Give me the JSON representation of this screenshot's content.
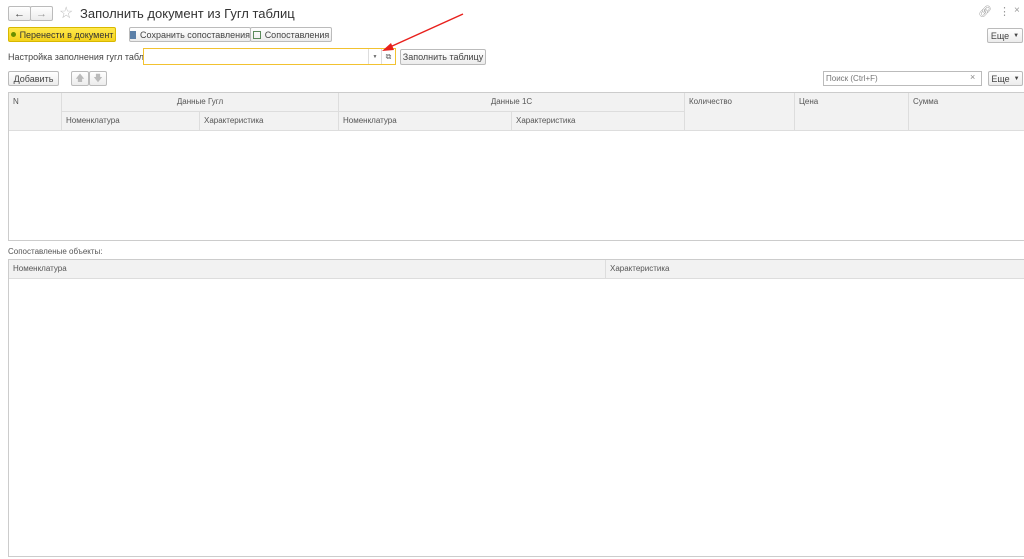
{
  "header": {
    "title": "Заполнить документ из Гугл таблиц",
    "back": "←",
    "forward": "→"
  },
  "toolbar": {
    "transfer": "Перенести в документ",
    "save_mapping": "Сохранить сопоставления",
    "mappings": "Сопоставления",
    "more": "Еще"
  },
  "settings": {
    "label": "Настройка заполнения гугл таблицы:",
    "value": "",
    "fill_button": "Заполнить таблицу"
  },
  "table_toolbar": {
    "add": "Добавить",
    "search_placeholder": "Поиск (Ctrl+F)",
    "more": "Еще"
  },
  "main_table": {
    "columns": {
      "n": "N",
      "google": "Данные Гугл",
      "onec": "Данные 1С",
      "qty": "Количество",
      "price": "Цена",
      "sum": "Сумма",
      "nom": "Номенклатура",
      "char": "Характеристика"
    },
    "rows": []
  },
  "matched": {
    "label": "Сопоставленые объекты:",
    "columns": [
      "Номенклатура",
      "Характеристика"
    ],
    "rows": []
  },
  "colors": {
    "accent": "#f4d21c",
    "arrow": "#e8201c"
  }
}
